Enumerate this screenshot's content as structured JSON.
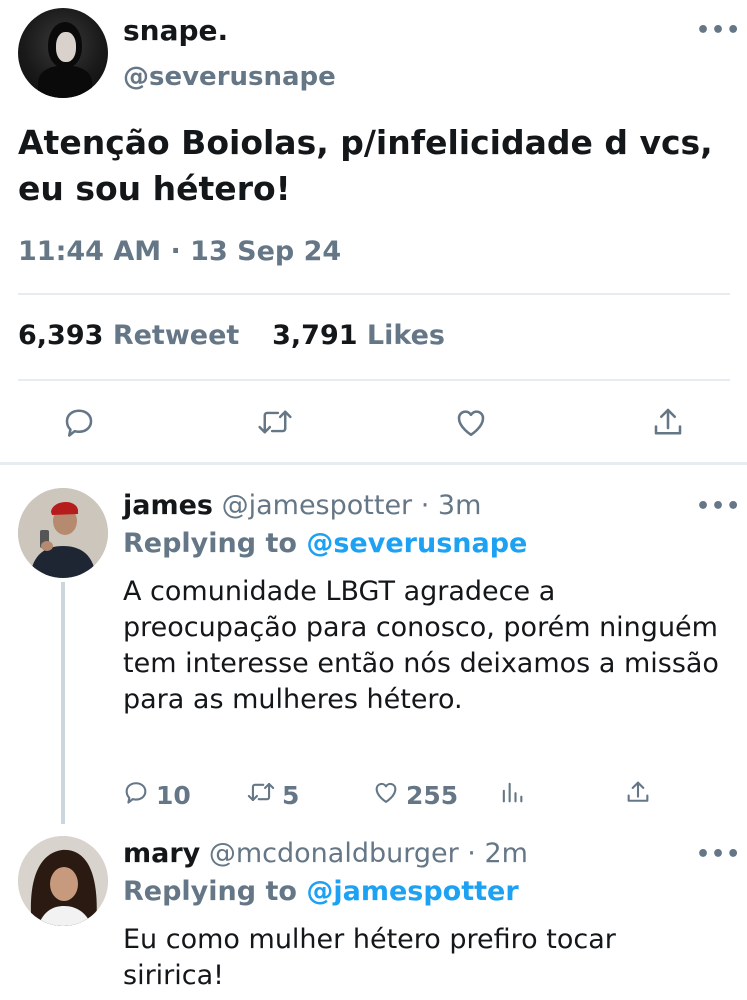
{
  "tweet": {
    "name": "snape.",
    "handle": "@severusnape",
    "text": "Atenção Boiolas, p/infelicidade d vcs, eu sou hétero!",
    "time": "11:44 AM · 13 Sep 24",
    "retweets": "6,393",
    "retweets_label": "Retweet",
    "likes": "3,791",
    "likes_label": "Likes",
    "more": "•••"
  },
  "replies": [
    {
      "name": "james",
      "meta": "@jamespotter · 3m",
      "replying_prefix": "Replying to",
      "replying_to": "@severusnape",
      "text": "A comunidade LBGT agradece a preocupação para conosco, porém ninguém tem interesse então nós deixamos a missão para as mulheres hétero.",
      "reply_count": "10",
      "retweet_count": "5",
      "like_count": "255",
      "more": "•••"
    },
    {
      "name": "mary",
      "meta": "@mcdonaldburger · 2m",
      "replying_prefix": "Replying to",
      "replying_to": "@jamespotter",
      "text": "Eu como mulher hétero prefiro tocar siririca!",
      "more": "•••"
    }
  ],
  "icons": {
    "reply": "speech-bubble",
    "retweet": "retweet-arrows",
    "like": "heart",
    "share": "upload-arrow",
    "analytics": "bar-chart"
  },
  "colors": {
    "text": "#14171a",
    "secondary": "#657786",
    "accent": "#1da1f2",
    "divider": "#e6ecf0"
  }
}
